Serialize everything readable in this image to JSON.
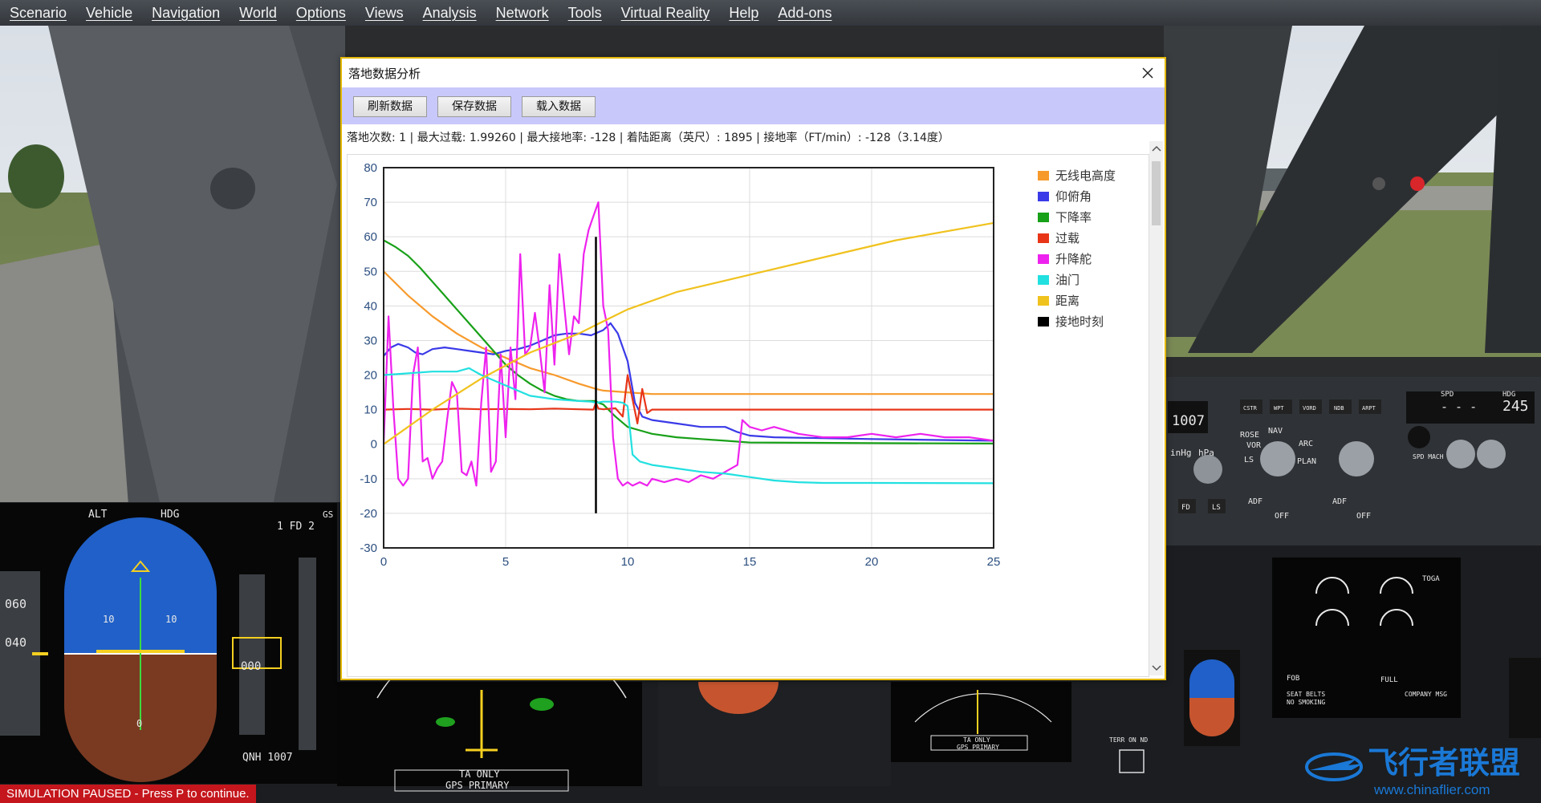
{
  "menu": [
    "Scenario",
    "Vehicle",
    "Navigation",
    "World",
    "Options",
    "Views",
    "Analysis",
    "Network",
    "Tools",
    "Virtual Reality",
    "Help",
    "Add-ons"
  ],
  "status": {
    "paused": "SIMULATION PAUSED - Press P to continue."
  },
  "watermark": {
    "brand": "飞行者联盟",
    "url": "www.chinaflier.com"
  },
  "cockpit": {
    "pfd": {
      "alt": "ALT",
      "hdg": "HDG",
      "fd": "1 FD 2",
      "gs": "GS",
      "qnh": "QNH  1007",
      "speed_hi": "060",
      "speed_lo": "040",
      "alt_lo": "000",
      "pitch_l": "10",
      "pitch_r": "10",
      "zero": "0"
    },
    "fcu": {
      "qnh_val": "1007",
      "inhg": "inHg",
      "hpa": "hPa",
      "rose": "ROSE",
      "nav": "NAV",
      "vor": "VOR",
      "arc": "ARC",
      "ils": "LS",
      "plan": "PLAN",
      "spd": "SPD",
      "hdg": "HDG",
      "spd_val": "- - -",
      "hdg_val": "245",
      "mach": "SPD MACH",
      "fd_btn": "FD",
      "ls_btn": "LS",
      "adf": "ADF",
      "off": "OFF",
      "efis_btns": [
        "CSTR",
        "WPT",
        "VORD",
        "NDB",
        "ARPT"
      ]
    },
    "nd": {
      "ta_only": "TA ONLY",
      "gps_primary": "GPS PRIMARY"
    },
    "ecam": {
      "toga": "TOGA",
      "fob": "FOB",
      "seat_belts": "SEAT BELTS",
      "no_smoking": "NO SMOKING",
      "company_msg": "COMPANY MSG",
      "full": "FULL",
      "terr_on_nd": "TERR ON ND"
    }
  },
  "window": {
    "title": "落地数据分析",
    "buttons": {
      "refresh": "刷新数据",
      "save": "保存数据",
      "load": "载入数据"
    },
    "stats": "落地次数: 1 | 最大过载: 1.99260 | 最大接地率: -128 | 着陆距离（英尺）: 1895 | 接地率（FT/min）: -128（3.14度）"
  },
  "chart_data": {
    "type": "line",
    "xlim": [
      0,
      25
    ],
    "ylim": [
      -30,
      80
    ],
    "x_ticks": [
      "0",
      "5",
      "10",
      "15",
      "20",
      "25"
    ],
    "y_ticks": [
      "80",
      "70",
      "60",
      "50",
      "40",
      "30",
      "20",
      "10",
      "0",
      "-10",
      "-20",
      "-30"
    ],
    "grid": true,
    "legend_position": "top-right",
    "series": [
      {
        "name": "无线电高度",
        "color": "#f79a2c",
        "x": [
          0,
          1,
          2,
          3,
          4,
          5,
          6,
          7,
          8,
          8.7,
          9,
          10,
          11,
          12,
          15,
          20,
          25
        ],
        "y": [
          50,
          43,
          37,
          32,
          28,
          25,
          22,
          20,
          17.5,
          16,
          15.5,
          15,
          14.5,
          14.5,
          14.5,
          14.5,
          14.5
        ]
      },
      {
        "name": "仰俯角",
        "color": "#3a3ae8",
        "x": [
          0,
          0.3,
          0.6,
          1,
          1.3,
          1.6,
          2,
          2.5,
          3,
          3.5,
          4,
          4.5,
          5,
          5.5,
          6,
          6.5,
          7,
          7.5,
          8,
          8.5,
          9,
          9.3,
          9.6,
          10,
          10.3,
          10.6,
          11,
          12,
          13,
          14,
          14.5,
          15,
          16,
          20,
          25
        ],
        "y": [
          25.5,
          28,
          29,
          28,
          26.5,
          26,
          27.5,
          28,
          27.5,
          27,
          26.5,
          26,
          27,
          27.5,
          28.5,
          30,
          31.5,
          32,
          32,
          31.5,
          33,
          35,
          32,
          24,
          12,
          8,
          7,
          6,
          5,
          5,
          3.5,
          2.5,
          2,
          1.5,
          1
        ]
      },
      {
        "name": "下降率",
        "color": "#18a018",
        "x": [
          0,
          0.5,
          1,
          1.5,
          2,
          2.5,
          3,
          3.5,
          4,
          4.5,
          5,
          5.5,
          6,
          6.5,
          7,
          7.5,
          8,
          8.5,
          8.7,
          8.8,
          9,
          9.5,
          10,
          10.5,
          11,
          12,
          13,
          14,
          15,
          20,
          25
        ],
        "y": [
          59,
          57,
          54.5,
          51,
          47,
          43,
          39,
          35,
          31,
          27,
          23,
          20,
          17.5,
          15.5,
          14,
          13,
          12.5,
          12.5,
          12.5,
          12,
          11.5,
          8,
          5,
          4,
          3,
          2,
          1.5,
          1,
          0.5,
          0.3,
          0.2
        ]
      },
      {
        "name": "过载",
        "color": "#e83518",
        "x": [
          0,
          1,
          2,
          3,
          4,
          5,
          6,
          7,
          8,
          8.6,
          8.7,
          8.8,
          9,
          9.5,
          9.8,
          10,
          10.2,
          10.4,
          10.6,
          10.8,
          11,
          12,
          15,
          20,
          25
        ],
        "y": [
          10,
          10.2,
          10,
          10.3,
          10.1,
          10.2,
          10.1,
          10.3,
          10.1,
          10,
          12,
          10.3,
          10.1,
          10.4,
          8,
          20,
          13,
          6,
          16,
          9,
          10,
          10,
          10,
          10,
          10
        ]
      },
      {
        "name": "升降舵",
        "color": "#ee22ee",
        "x": [
          0,
          0.2,
          0.4,
          0.6,
          0.8,
          1,
          1.2,
          1.4,
          1.6,
          1.8,
          2,
          2.2,
          2.4,
          2.6,
          2.8,
          3,
          3.2,
          3.4,
          3.6,
          3.8,
          4,
          4.2,
          4.4,
          4.6,
          4.8,
          5,
          5.2,
          5.4,
          5.6,
          5.8,
          6,
          6.2,
          6.4,
          6.6,
          6.8,
          7,
          7.2,
          7.4,
          7.6,
          7.8,
          8,
          8.2,
          8.4,
          8.6,
          8.8,
          9,
          9.2,
          9.4,
          9.6,
          9.8,
          10,
          10.2,
          10.5,
          10.8,
          11,
          11.5,
          12,
          12.5,
          13,
          13.5,
          14,
          14.5,
          14.7,
          15,
          15.5,
          16,
          17,
          18,
          19,
          20,
          21,
          22,
          23,
          24,
          25
        ],
        "y": [
          0,
          37,
          10,
          -10,
          -12,
          -10,
          20,
          28,
          -5,
          -4,
          -10,
          -7,
          -5,
          7,
          18,
          15,
          -8,
          -9,
          -5,
          -12,
          12,
          28,
          -8,
          -5,
          26,
          2,
          28,
          13,
          55,
          26,
          28,
          38,
          27,
          15,
          46,
          23,
          55,
          40,
          26,
          37,
          35,
          55,
          62,
          66,
          70,
          40,
          33,
          2,
          -10,
          -12,
          -11,
          -12,
          -11,
          -12,
          -10,
          -11,
          -10,
          -11,
          -9,
          -10,
          -8,
          -6,
          7,
          5,
          4,
          5,
          3,
          2,
          2,
          3,
          2,
          3,
          2,
          2,
          1
        ]
      },
      {
        "name": "油门",
        "color": "#22e0e0",
        "x": [
          0,
          1,
          2,
          3,
          3.5,
          4,
          5,
          6,
          7,
          8,
          8.5,
          8.7,
          9,
          9.5,
          9.8,
          10,
          10.2,
          10.5,
          11,
          12,
          13,
          14,
          15,
          16,
          17,
          18,
          20,
          25
        ],
        "y": [
          20,
          20.5,
          21,
          21,
          22,
          20,
          17,
          14,
          13,
          12.5,
          12.3,
          12,
          12.3,
          12.3,
          12,
          11,
          -3,
          -5,
          -6,
          -7,
          -8,
          -8.5,
          -9.5,
          -10.5,
          -11,
          -11.2,
          -11.2,
          -11.3
        ]
      },
      {
        "name": "距离",
        "color": "#f0c21e",
        "x": [
          0,
          2,
          4,
          6,
          8,
          8.7,
          10,
          12,
          15,
          18,
          21,
          25
        ],
        "y": [
          0,
          10,
          19,
          26.5,
          32,
          34.5,
          39,
          44,
          49,
          54,
          59,
          64
        ]
      },
      {
        "name": "接地时刻",
        "color": "#000000",
        "x": [
          8.7,
          8.7
        ],
        "y": [
          60,
          -20
        ]
      }
    ]
  }
}
